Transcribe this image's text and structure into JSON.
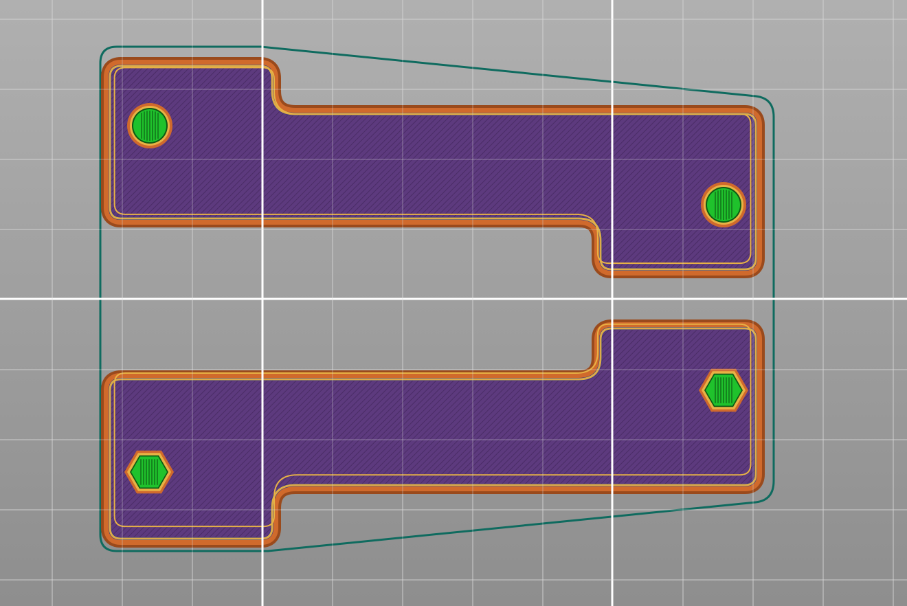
{
  "viewport": {
    "grid_visible": true
  },
  "colors": {
    "bed_top": "#b0b0b0",
    "bed_bottom": "#8e8e8e",
    "grid_minor": "#d6d6d6",
    "grid_major": "#ffffff",
    "skirt": "#0f6b5f",
    "brim_outer": "#9a4a1c",
    "brim_inner": "#d06a2c",
    "perimeter_external": "#1e2f8c",
    "perimeter": "#e8b245",
    "perimeter_inner": "#9a6a20",
    "infill": "#5d3a7e",
    "infill_hatch": "#4a2c66",
    "insert_fill": "#1fc22c",
    "insert_outline": "#0d5a14"
  },
  "objects": [
    {
      "id": "part-top",
      "type": "bracket",
      "holes": [
        "round",
        "round"
      ]
    },
    {
      "id": "part-bottom",
      "type": "bracket",
      "holes": [
        "hex",
        "hex"
      ]
    }
  ]
}
